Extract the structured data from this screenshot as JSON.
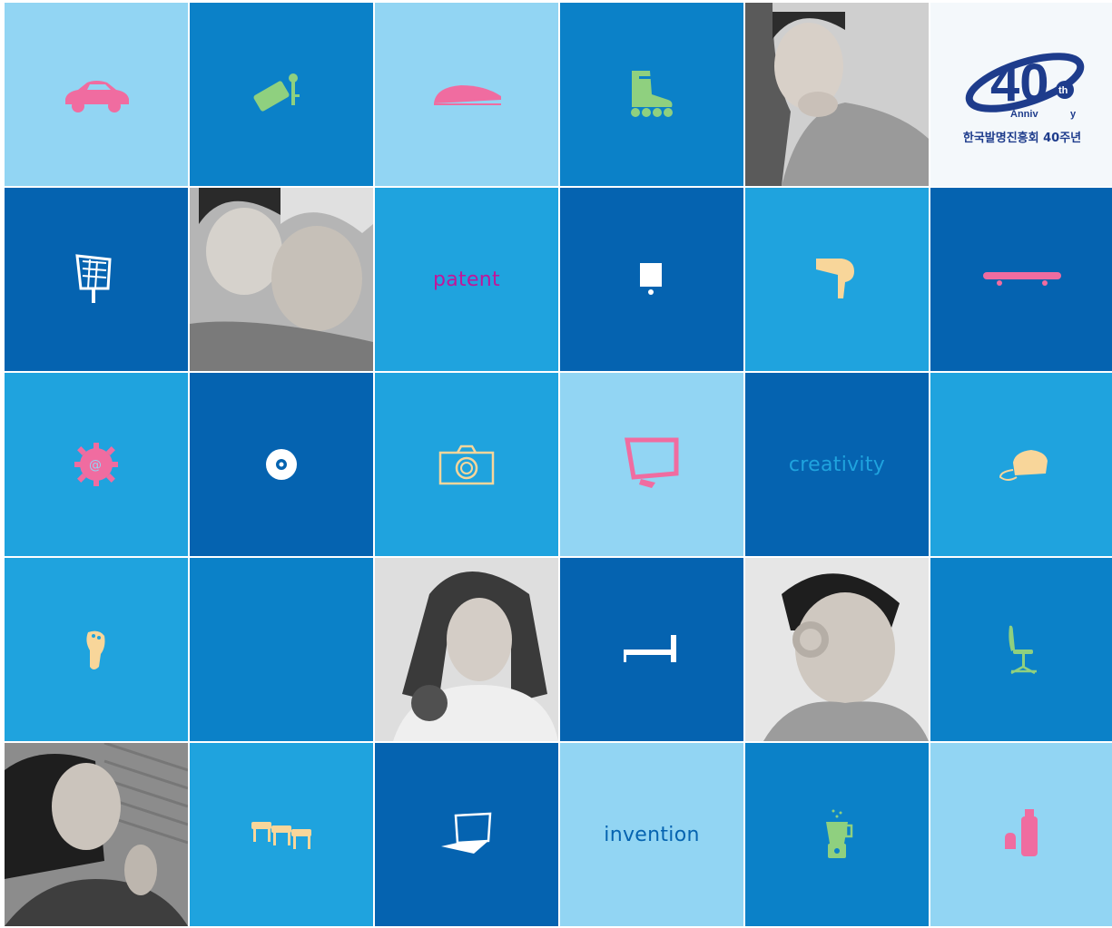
{
  "logo": {
    "caption": "한국발명진흥회 40주년",
    "number": "40",
    "superscript": "th",
    "anniversary_left": "Anniv",
    "anniversary_right": "y"
  },
  "words": {
    "patent": "patent",
    "creativity": "creativity",
    "invention": "invention"
  },
  "colors": {
    "light_blue": "#92d5f3",
    "medium_blue": "#0b81c8",
    "sky_blue": "#1fa3de",
    "dark_blue": "#0563b0",
    "pink": "#f06ca0",
    "green": "#8fd07f",
    "cream": "#f8d69a",
    "white": "#ffffff",
    "magenta_text": "#c0169a",
    "navy_text": "#1e3c8c"
  },
  "icons": [
    "car-icon",
    "key-tag-icon",
    "bullet-train-icon",
    "roller-skate-icon",
    "solar-panel-icon",
    "sign-icon",
    "hair-dryer-icon",
    "skateboard-icon",
    "gear-at-icon",
    "cd-icon",
    "camera-icon",
    "monitor-icon",
    "telephone-icon",
    "foot-icon",
    "bed-icon",
    "office-chair-icon",
    "tables-icon",
    "laptop-icon",
    "blender-icon",
    "usb-drive-icon"
  ]
}
